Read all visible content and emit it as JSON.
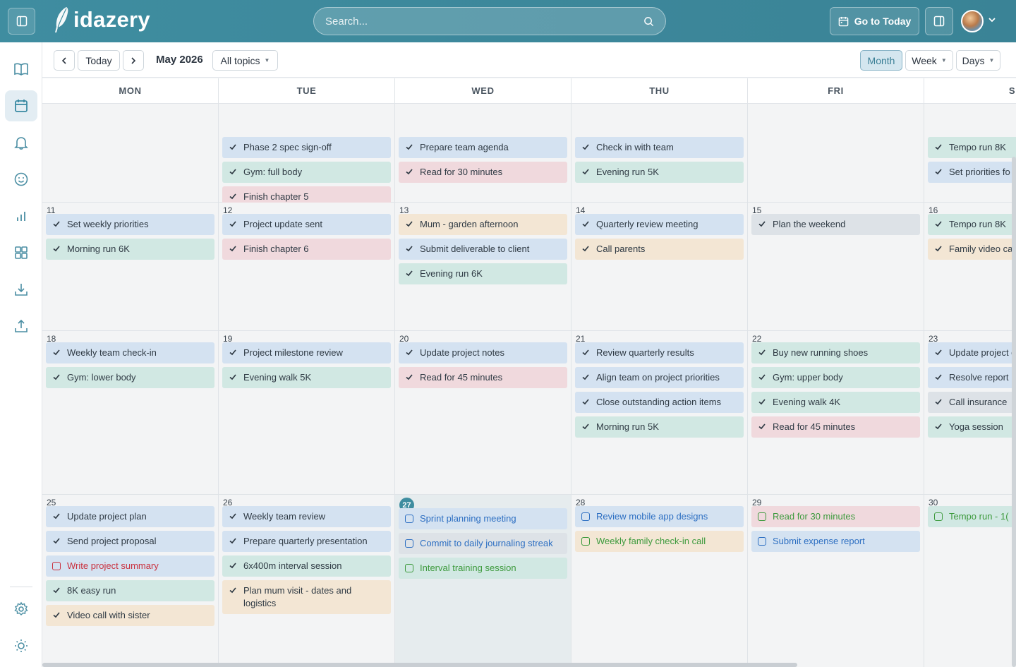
{
  "app": {
    "name": "idazery"
  },
  "header": {
    "search_placeholder": "Search...",
    "goto_today_label": "Go to Today"
  },
  "toolbar": {
    "today_label": "Today",
    "period_label": "May 2026",
    "topic_filter": "All topics",
    "view_month": "Month",
    "view_week": "Week",
    "view_days": "Days"
  },
  "days_of_week": [
    "MON",
    "TUE",
    "WED",
    "THU",
    "FRI",
    "S"
  ],
  "weeks": [
    {
      "days": [
        {
          "num": "",
          "events": []
        },
        {
          "num": "",
          "events": [
            {
              "title": "Phase 2 spec sign-off",
              "color": "blue",
              "done": true
            },
            {
              "title": "Gym: full body",
              "color": "green",
              "done": true
            },
            {
              "title": "Finish chapter 5",
              "color": "pink",
              "done": true
            }
          ]
        },
        {
          "num": "",
          "events": [
            {
              "title": "Prepare team agenda",
              "color": "blue",
              "done": true
            },
            {
              "title": "Read for 30 minutes",
              "color": "pink",
              "done": true
            }
          ]
        },
        {
          "num": "",
          "events": [
            {
              "title": "Check in with team",
              "color": "blue",
              "done": true
            },
            {
              "title": "Evening run 5K",
              "color": "green",
              "done": true
            }
          ]
        },
        {
          "num": "",
          "events": []
        },
        {
          "num": "",
          "events": [
            {
              "title": "Tempo run 8K",
              "color": "green",
              "done": true
            },
            {
              "title": "Set priorities fo",
              "color": "blue",
              "done": true
            }
          ]
        }
      ]
    },
    {
      "days": [
        {
          "num": "11",
          "events": [
            {
              "title": "Set weekly priorities",
              "color": "blue",
              "done": true
            },
            {
              "title": "Morning run 6K",
              "color": "green",
              "done": true
            }
          ]
        },
        {
          "num": "12",
          "events": [
            {
              "title": "Project update sent",
              "color": "blue",
              "done": true
            },
            {
              "title": "Finish chapter 6",
              "color": "pink",
              "done": true
            }
          ]
        },
        {
          "num": "13",
          "events": [
            {
              "title": "Mum - garden afternoon",
              "color": "cream",
              "done": true
            },
            {
              "title": "Submit deliverable to client",
              "color": "blue",
              "done": true
            },
            {
              "title": "Evening run 6K",
              "color": "green",
              "done": true
            }
          ]
        },
        {
          "num": "14",
          "events": [
            {
              "title": "Quarterly review meeting",
              "color": "blue",
              "done": true
            },
            {
              "title": "Call parents",
              "color": "cream",
              "done": true
            }
          ]
        },
        {
          "num": "15",
          "events": [
            {
              "title": "Plan the weekend",
              "color": "gray",
              "done": true
            }
          ]
        },
        {
          "num": "16",
          "events": [
            {
              "title": "Tempo run 8K",
              "color": "green",
              "done": true
            },
            {
              "title": "Family video ca",
              "color": "cream",
              "done": true
            }
          ]
        }
      ]
    },
    {
      "days": [
        {
          "num": "18",
          "events": [
            {
              "title": "Weekly team check-in",
              "color": "blue",
              "done": true
            },
            {
              "title": "Gym: lower body",
              "color": "green",
              "done": true
            }
          ]
        },
        {
          "num": "19",
          "events": [
            {
              "title": "Project milestone review",
              "color": "blue",
              "done": true
            },
            {
              "title": "Evening walk 5K",
              "color": "green",
              "done": true
            }
          ]
        },
        {
          "num": "20",
          "events": [
            {
              "title": "Update project notes",
              "color": "blue",
              "done": true
            },
            {
              "title": "Read for 45 minutes",
              "color": "pink",
              "done": true
            }
          ]
        },
        {
          "num": "21",
          "events": [
            {
              "title": "Review quarterly results",
              "color": "blue",
              "done": true
            },
            {
              "title": "Align team on project priorities",
              "color": "blue",
              "done": true
            },
            {
              "title": "Close outstanding action items",
              "color": "blue",
              "done": true
            },
            {
              "title": "Morning run 5K",
              "color": "green",
              "done": true
            }
          ]
        },
        {
          "num": "22",
          "events": [
            {
              "title": "Buy new running shoes",
              "color": "green",
              "done": true
            },
            {
              "title": "Gym: upper body",
              "color": "green",
              "done": true
            },
            {
              "title": "Evening walk 4K",
              "color": "green",
              "done": true
            },
            {
              "title": "Read for 45 minutes",
              "color": "pink",
              "done": true
            }
          ]
        },
        {
          "num": "23",
          "events": [
            {
              "title": "Update project documentation",
              "color": "blue",
              "done": true
            },
            {
              "title": "Resolve report",
              "color": "blue",
              "done": true
            },
            {
              "title": "Call insurance",
              "color": "gray",
              "done": true
            },
            {
              "title": "Yoga session",
              "color": "green",
              "done": true
            }
          ]
        }
      ]
    },
    {
      "days": [
        {
          "num": "25",
          "events": [
            {
              "title": "Update project plan",
              "color": "blue",
              "done": true
            },
            {
              "title": "Send project proposal",
              "color": "blue",
              "done": true
            },
            {
              "title": "Write project summary",
              "color": "blue",
              "done": false
            },
            {
              "title": "8K easy run",
              "color": "green",
              "done": true
            },
            {
              "title": "Video call with sister",
              "color": "cream",
              "done": true
            }
          ]
        },
        {
          "num": "26",
          "events": [
            {
              "title": "Weekly team review",
              "color": "blue",
              "done": true
            },
            {
              "title": "Prepare quarterly presentation",
              "color": "blue",
              "done": true
            },
            {
              "title": "6x400m interval session",
              "color": "green",
              "done": true
            },
            {
              "title": "Plan mum visit - dates and logistics",
              "color": "cream",
              "done": true
            }
          ]
        },
        {
          "num": "27",
          "today": true,
          "events": [
            {
              "title": "Sprint planning meeting",
              "color": "blue",
              "done": false
            },
            {
              "title": "Commit to daily journaling streak",
              "color": "gray",
              "done": false
            },
            {
              "title": "Interval training session",
              "color": "green",
              "done": false
            }
          ]
        },
        {
          "num": "28",
          "events": [
            {
              "title": "Review mobile app designs",
              "color": "blue",
              "done": false
            },
            {
              "title": "Weekly family check-in call",
              "color": "cream",
              "done": false
            }
          ]
        },
        {
          "num": "29",
          "events": [
            {
              "title": "Read for 30 minutes",
              "color": "pink",
              "done": false
            },
            {
              "title": "Submit expense report",
              "color": "blue",
              "done": false
            }
          ]
        },
        {
          "num": "30",
          "events": [
            {
              "title": "Tempo run - 1(",
              "color": "green",
              "done": false
            }
          ]
        }
      ]
    }
  ]
}
